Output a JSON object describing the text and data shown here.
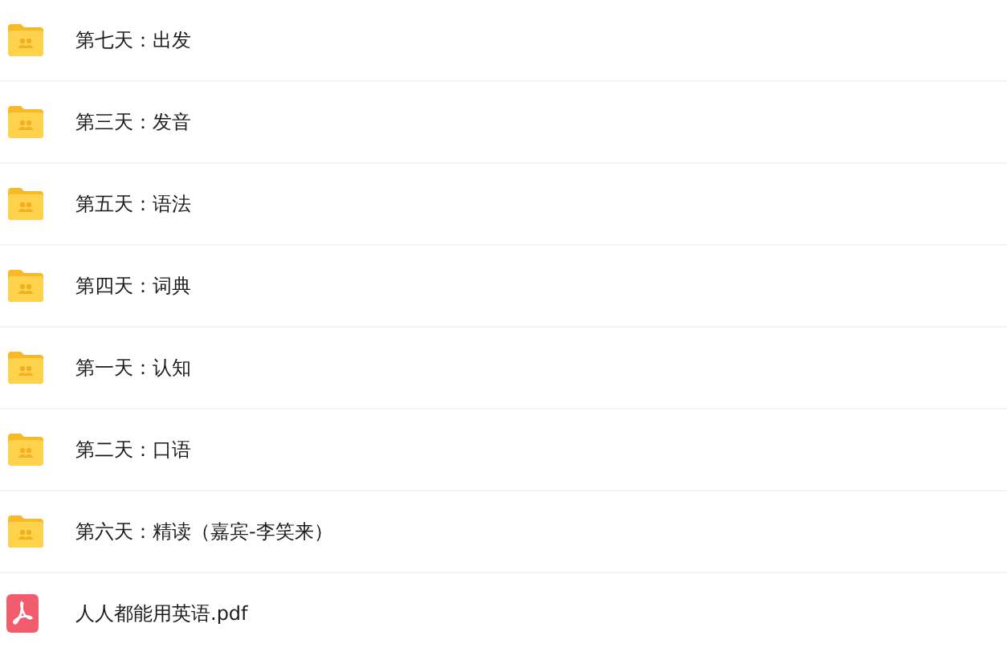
{
  "files": [
    {
      "kind": "folder",
      "name": "第七天：出发"
    },
    {
      "kind": "folder",
      "name": "第三天：发音"
    },
    {
      "kind": "folder",
      "name": "第五天：语法"
    },
    {
      "kind": "folder",
      "name": "第四天：词典"
    },
    {
      "kind": "folder",
      "name": "第一天：认知"
    },
    {
      "kind": "folder",
      "name": "第二天：口语"
    },
    {
      "kind": "folder",
      "name": "第六天：精读（嘉宾-李笑来）"
    },
    {
      "kind": "pdf",
      "name": "人人都能用英语.pdf"
    }
  ]
}
